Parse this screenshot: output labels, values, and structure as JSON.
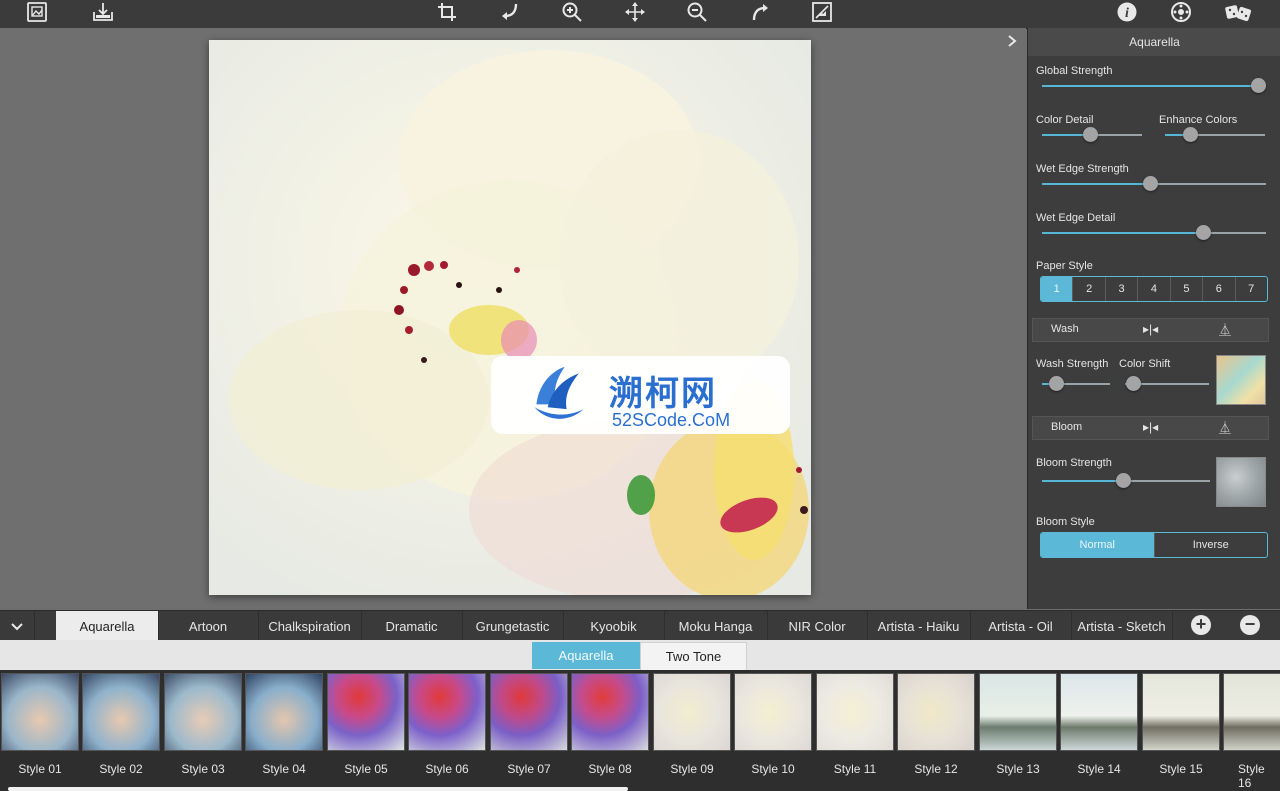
{
  "toolbar": {
    "left_icons": [
      "open-image-icon",
      "save-image-icon"
    ],
    "center_icons": [
      "crop-icon",
      "undo-icon",
      "zoom-in-icon",
      "move-icon",
      "zoom-out-icon",
      "redo-icon",
      "compare-icon"
    ],
    "right_icons": [
      "info-icon",
      "settings-icon",
      "random-dice-icon"
    ]
  },
  "watermark": {
    "title": "溯柯网",
    "subtitle": "52SCode.CoM"
  },
  "panel": {
    "title": "Aquarella",
    "global_strength": {
      "label": "Global Strength",
      "value": 1.0
    },
    "color_detail": {
      "label": "Color Detail",
      "value": 0.48
    },
    "enhance_colors": {
      "label": "Enhance Colors",
      "value": 0.25
    },
    "wet_edge_strength": {
      "label": "Wet Edge Strength",
      "value": 0.48
    },
    "wet_edge_detail": {
      "label": "Wet Edge Detail",
      "value": 0.72
    },
    "paper_style": {
      "label": "Paper Style",
      "options": [
        "1",
        "2",
        "3",
        "4",
        "5",
        "6",
        "7"
      ],
      "selected": "1"
    },
    "wash": {
      "label": "Wash"
    },
    "wash_strength": {
      "label": "Wash Strength",
      "value": 0.2
    },
    "color_shift": {
      "label": "Color Shift",
      "value": 0.1
    },
    "bloom": {
      "label": "Bloom"
    },
    "bloom_strength": {
      "label": "Bloom Strength",
      "value": 0.48
    },
    "bloom_style": {
      "label": "Bloom Style",
      "options": [
        "Normal",
        "Inverse"
      ],
      "selected": "Normal"
    }
  },
  "style_tabs": {
    "items": [
      "Aquarella",
      "Artoon",
      "Chalkspiration",
      "Dramatic",
      "Grungetastic",
      "Kyoobik",
      "Moku Hanga",
      "NIR Color",
      "Artista - Haiku",
      "Artista - Oil",
      "Artista - Sketch"
    ],
    "active": "Aquarella",
    "add_label": "+",
    "remove_label": "−"
  },
  "sub_tabs": {
    "items": [
      "Aquarella",
      "Two Tone"
    ],
    "active": "Aquarella"
  },
  "thumbnails": {
    "items": [
      "Style 01",
      "Style 02",
      "Style 03",
      "Style 04",
      "Style 05",
      "Style 06",
      "Style 07",
      "Style 08",
      "Style 09",
      "Style 10",
      "Style 11",
      "Style 12",
      "Style 13",
      "Style 14",
      "Style 15",
      "Style 16"
    ]
  },
  "colors": {
    "accent": "#5bb8d6",
    "panel_bg": "#3d3d3d",
    "toolbar_bg": "#3b3b3b",
    "canvas_bg": "#6f6f6f"
  }
}
